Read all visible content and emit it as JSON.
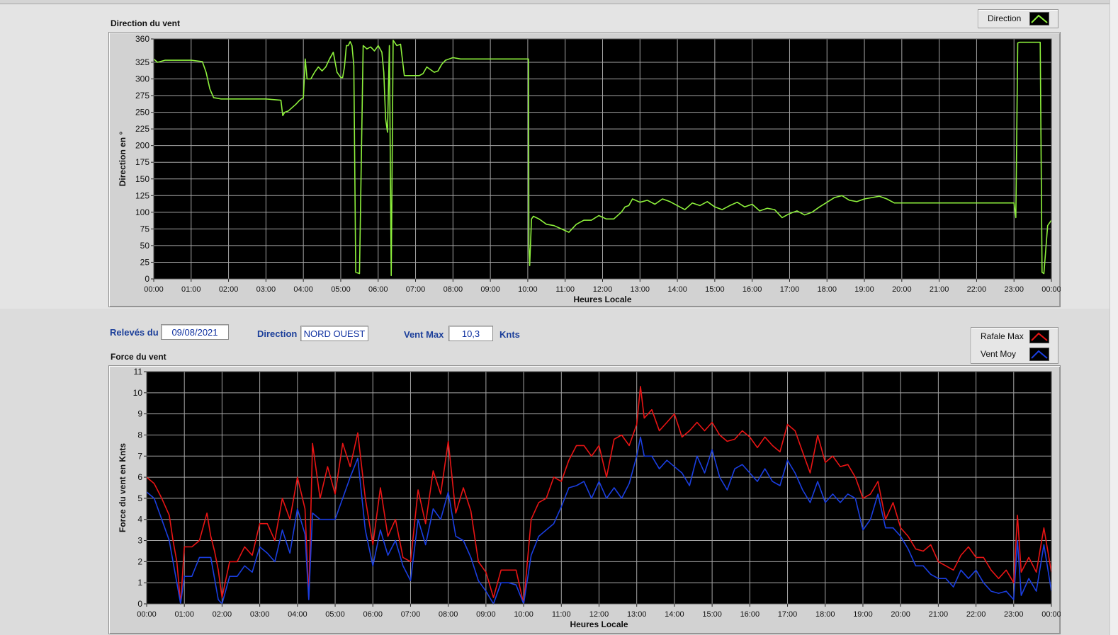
{
  "colors": {
    "background": "#000000",
    "grid": "#a5a5a5",
    "direction_line": "#8df03c",
    "gust_line": "#e81414",
    "avg_line": "#1a3ee0",
    "info_label": "#1c3f9a",
    "info_value": "#0d2fa0"
  },
  "direction_panel": {
    "title": "Direction du vent",
    "legend": {
      "label": "Direction",
      "icon": "line-plot-icon"
    }
  },
  "info_bar": {
    "date_label": "Relevés du",
    "date_value": "09/08/2021",
    "direction_label": "Direction",
    "direction_value": "NORD OUEST",
    "vmax_label": "Vent Max",
    "vmax_value": "10,3",
    "vmax_unit": "Knts"
  },
  "force_panel": {
    "title": "Force du vent",
    "legend": [
      {
        "label": "Rafale Max",
        "icon": "line-plot-icon"
      },
      {
        "label": "Vent Moy",
        "icon": "line-plot-icon"
      }
    ]
  },
  "chart_data": [
    {
      "type": "line",
      "title": "Direction du vent",
      "xlabel": "Heures Locale",
      "ylabel": "Direction en °",
      "ylim": [
        0,
        360
      ],
      "yticks": [
        "0",
        "25",
        "50",
        "75",
        "100",
        "125",
        "150",
        "175",
        "200",
        "225",
        "250",
        "275",
        "300",
        "325",
        "360"
      ],
      "xticks": [
        "00:00",
        "01:00",
        "02:00",
        "03:00",
        "04:00",
        "05:00",
        "06:00",
        "07:00",
        "08:00",
        "09:00",
        "10:00",
        "11:00",
        "12:00",
        "13:00",
        "14:00",
        "15:00",
        "16:00",
        "17:00",
        "18:00",
        "19:00",
        "20:00",
        "21:00",
        "22:00",
        "23:00",
        "00:00"
      ],
      "xlim": [
        0,
        24
      ],
      "grid": true,
      "series": [
        {
          "name": "Direction",
          "x": [
            0,
            0.1,
            0.3,
            0.5,
            0.8,
            1.0,
            1.3,
            1.4,
            1.5,
            1.6,
            1.7,
            1.8,
            2.0,
            2.5,
            3.0,
            3.4,
            3.45,
            3.5,
            3.6,
            3.8,
            3.9,
            4.0,
            4.05,
            4.1,
            4.15,
            4.2,
            4.3,
            4.4,
            4.5,
            4.6,
            4.7,
            4.8,
            4.9,
            5.0,
            5.05,
            5.1,
            5.15,
            5.2,
            5.25,
            5.3,
            5.35,
            5.4,
            5.5,
            5.6,
            5.7,
            5.8,
            5.9,
            6.0,
            6.1,
            6.15,
            6.2,
            6.25,
            6.3,
            6.35,
            6.4,
            6.5,
            6.6,
            6.7,
            6.8,
            7.0,
            7.1,
            7.2,
            7.3,
            7.5,
            7.6,
            7.7,
            7.8,
            8.0,
            8.2,
            8.5,
            9.0,
            9.5,
            10.0,
            10.02,
            10.03,
            10.05,
            10.1,
            10.15,
            10.3,
            10.5,
            10.7,
            10.9,
            11.1,
            11.3,
            11.5,
            11.7,
            11.9,
            12.1,
            12.3,
            12.5,
            12.6,
            12.7,
            12.8,
            13.0,
            13.2,
            13.4,
            13.6,
            13.8,
            14.0,
            14.2,
            14.4,
            14.6,
            14.8,
            15.0,
            15.2,
            15.4,
            15.6,
            15.8,
            16.0,
            16.2,
            16.4,
            16.6,
            16.8,
            17.0,
            17.2,
            17.4,
            17.6,
            17.8,
            18.0,
            18.2,
            18.4,
            18.6,
            18.8,
            19.0,
            19.2,
            19.4,
            19.6,
            19.8,
            20.0,
            20.1,
            20.5,
            21.0,
            21.5,
            22.0,
            22.5,
            23.0,
            23.05,
            23.1,
            23.15,
            23.3,
            23.5,
            23.6,
            23.7,
            23.75,
            23.8,
            23.9,
            24.0
          ],
          "y": [
            330,
            325,
            328,
            328,
            328,
            328,
            326,
            310,
            285,
            272,
            271,
            270,
            270,
            270,
            270,
            268,
            245,
            250,
            252,
            262,
            268,
            272,
            330,
            300,
            300,
            300,
            310,
            318,
            312,
            318,
            330,
            340,
            310,
            302,
            302,
            318,
            350,
            350,
            356,
            350,
            320,
            10,
            8,
            350,
            345,
            348,
            342,
            350,
            340,
            310,
            240,
            220,
            350,
            5,
            358,
            350,
            352,
            305,
            305,
            305,
            305,
            308,
            318,
            310,
            312,
            322,
            328,
            332,
            330,
            330,
            330,
            330,
            330,
            330,
            50,
            20,
            90,
            94,
            90,
            82,
            80,
            75,
            70,
            82,
            88,
            88,
            95,
            90,
            90,
            100,
            108,
            110,
            120,
            115,
            118,
            112,
            120,
            116,
            110,
            104,
            114,
            110,
            116,
            108,
            104,
            110,
            115,
            108,
            112,
            102,
            106,
            104,
            92,
            98,
            102,
            96,
            100,
            108,
            115,
            122,
            125,
            118,
            116,
            120,
            122,
            124,
            120,
            114,
            114,
            114,
            114,
            114,
            114,
            114,
            114,
            114,
            92,
            354,
            355,
            355,
            355,
            355,
            355,
            10,
            8,
            80,
            88
          ]
        }
      ]
    },
    {
      "type": "line",
      "title": "Force du vent",
      "xlabel": "Heures Locale",
      "ylabel": "Force du vent en Knts",
      "ylim": [
        0,
        11
      ],
      "yticks": [
        "0",
        "1",
        "2",
        "3",
        "4",
        "5",
        "6",
        "7",
        "8",
        "9",
        "10",
        "11"
      ],
      "xticks": [
        "00:00",
        "01:00",
        "02:00",
        "03:00",
        "04:00",
        "05:00",
        "06:00",
        "07:00",
        "08:00",
        "09:00",
        "10:00",
        "11:00",
        "12:00",
        "13:00",
        "14:00",
        "15:00",
        "16:00",
        "17:00",
        "18:00",
        "19:00",
        "20:00",
        "21:00",
        "22:00",
        "23:00",
        "00:00"
      ],
      "xlim": [
        0,
        24
      ],
      "grid": true,
      "series": [
        {
          "name": "Rafale Max",
          "x": [
            0,
            0.2,
            0.4,
            0.6,
            0.7,
            0.8,
            0.9,
            1.0,
            1.2,
            1.4,
            1.6,
            1.7,
            1.8,
            1.9,
            2.0,
            2.2,
            2.4,
            2.6,
            2.8,
            3.0,
            3.2,
            3.4,
            3.6,
            3.8,
            4.0,
            4.2,
            4.3,
            4.4,
            4.6,
            4.8,
            5.0,
            5.2,
            5.4,
            5.6,
            5.8,
            6.0,
            6.2,
            6.4,
            6.6,
            6.8,
            7.0,
            7.2,
            7.4,
            7.6,
            7.8,
            8.0,
            8.2,
            8.4,
            8.6,
            8.8,
            9.0,
            9.2,
            9.4,
            9.6,
            9.8,
            10.0,
            10.2,
            10.4,
            10.6,
            10.8,
            11.0,
            11.2,
            11.4,
            11.6,
            11.8,
            12.0,
            12.2,
            12.4,
            12.6,
            12.8,
            13.0,
            13.1,
            13.2,
            13.4,
            13.6,
            13.8,
            14.0,
            14.2,
            14.4,
            14.6,
            14.8,
            15.0,
            15.2,
            15.4,
            15.6,
            15.8,
            16.0,
            16.2,
            16.4,
            16.6,
            16.8,
            17.0,
            17.2,
            17.4,
            17.6,
            17.8,
            18.0,
            18.2,
            18.4,
            18.6,
            18.8,
            19.0,
            19.2,
            19.4,
            19.6,
            19.8,
            20.0,
            20.2,
            20.4,
            20.6,
            20.8,
            21.0,
            21.2,
            21.4,
            21.6,
            21.8,
            22.0,
            22.2,
            22.4,
            22.6,
            22.8,
            23.0,
            23.1,
            23.2,
            23.4,
            23.6,
            23.8,
            24.0
          ],
          "y": [
            6,
            5.7,
            5,
            4.2,
            3,
            2,
            0,
            2.7,
            2.7,
            3,
            4.3,
            3.2,
            2.5,
            1.6,
            0.3,
            2,
            2,
            2.7,
            2.3,
            3.8,
            3.8,
            3,
            5,
            4,
            6,
            4.5,
            0.3,
            7.6,
            5,
            6.5,
            5.2,
            7.6,
            6.5,
            8.1,
            5,
            2.8,
            5.5,
            3.2,
            4,
            2.2,
            2,
            5.4,
            3.8,
            6.3,
            5.2,
            7.7,
            4.3,
            5.5,
            4.4,
            2,
            1.5,
            0.3,
            1.6,
            1.6,
            1.6,
            0,
            4,
            4.8,
            5,
            6,
            5.8,
            6.8,
            7.5,
            7.5,
            7,
            7.5,
            6,
            7.8,
            8,
            7.5,
            8.5,
            10.3,
            8.8,
            9.2,
            8.2,
            8.6,
            9,
            7.9,
            8.2,
            8.6,
            8.2,
            8.6,
            8,
            7.7,
            7.8,
            8.2,
            7.9,
            7.4,
            7.9,
            7.5,
            7.2,
            8.5,
            8.2,
            7.2,
            6.2,
            8,
            6.7,
            7,
            6.5,
            6.6,
            6,
            5,
            5.2,
            5.8,
            4,
            4.8,
            3.6,
            3.2,
            2.6,
            2.5,
            2.8,
            2,
            1.8,
            1.6,
            2.3,
            2.7,
            2.2,
            2.2,
            1.6,
            1.2,
            1.6,
            1,
            4.2,
            1.5,
            2.2,
            1.5,
            3.6,
            1.5
          ]
        },
        {
          "name": "Vent Moy",
          "x": [
            0,
            0.2,
            0.4,
            0.6,
            0.7,
            0.8,
            0.9,
            1.0,
            1.2,
            1.4,
            1.6,
            1.7,
            1.8,
            1.9,
            2.0,
            2.2,
            2.4,
            2.6,
            2.8,
            3.0,
            3.2,
            3.4,
            3.6,
            3.8,
            4.0,
            4.2,
            4.3,
            4.4,
            4.6,
            4.8,
            5.0,
            5.2,
            5.4,
            5.6,
            5.8,
            6.0,
            6.2,
            6.4,
            6.6,
            6.8,
            7.0,
            7.2,
            7.4,
            7.6,
            7.8,
            8.0,
            8.2,
            8.4,
            8.6,
            8.8,
            9.0,
            9.2,
            9.4,
            9.6,
            9.8,
            10.0,
            10.2,
            10.4,
            10.6,
            10.8,
            11.0,
            11.2,
            11.4,
            11.6,
            11.8,
            12.0,
            12.2,
            12.4,
            12.6,
            12.8,
            13.0,
            13.1,
            13.2,
            13.4,
            13.6,
            13.8,
            14.0,
            14.2,
            14.4,
            14.6,
            14.8,
            15.0,
            15.2,
            15.4,
            15.6,
            15.8,
            16.0,
            16.2,
            16.4,
            16.6,
            16.8,
            17.0,
            17.2,
            17.4,
            17.6,
            17.8,
            18.0,
            18.2,
            18.4,
            18.6,
            18.8,
            19.0,
            19.2,
            19.4,
            19.6,
            19.8,
            20.0,
            20.2,
            20.4,
            20.6,
            20.8,
            21.0,
            21.2,
            21.4,
            21.6,
            21.8,
            22.0,
            22.2,
            22.4,
            22.6,
            22.8,
            23.0,
            23.1,
            23.2,
            23.4,
            23.6,
            23.8,
            24.0
          ],
          "y": [
            5.3,
            5,
            4,
            3,
            2,
            1,
            0,
            1.3,
            1.3,
            2.2,
            2.2,
            2.2,
            1.2,
            0.2,
            0,
            1.3,
            1.3,
            1.8,
            1.5,
            2.7,
            2.4,
            2,
            3.5,
            2.4,
            4.5,
            3.3,
            0.2,
            4.3,
            4,
            4,
            4,
            5,
            6,
            6.9,
            3.5,
            1.8,
            3.5,
            2.3,
            3,
            1.8,
            1.1,
            4,
            2.8,
            4.5,
            4,
            5.3,
            3.2,
            3,
            2.2,
            1.1,
            0.6,
            0,
            1,
            1,
            0.9,
            0,
            2.3,
            3.2,
            3.5,
            3.8,
            4.6,
            5.5,
            5.6,
            5.8,
            5,
            5.8,
            5,
            5.5,
            5,
            5.7,
            7,
            7.9,
            7,
            7,
            6.4,
            6.8,
            6.5,
            6.2,
            5.6,
            7,
            6.2,
            7.3,
            6,
            5.4,
            6.4,
            6.6,
            6.2,
            5.8,
            6.4,
            5.8,
            5.6,
            6.8,
            6.2,
            5.4,
            4.8,
            5.8,
            4.8,
            5.2,
            4.8,
            5.2,
            5,
            3.5,
            4,
            5.2,
            3.6,
            3.6,
            3.2,
            2.6,
            1.8,
            1.8,
            1.4,
            1.2,
            1.2,
            0.8,
            1.6,
            1.2,
            1.6,
            1,
            0.6,
            0.5,
            0.6,
            0.2,
            3,
            0.4,
            1.2,
            0.6,
            2.8,
            0.6
          ]
        }
      ]
    }
  ]
}
